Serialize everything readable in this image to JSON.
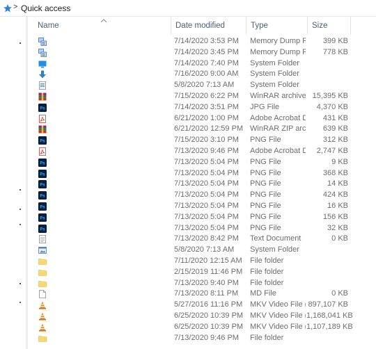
{
  "address": {
    "crumb": "Quick access",
    "separator": ">"
  },
  "columns": {
    "name": "Name",
    "date": "Date modified",
    "type": "Type",
    "size": "Size"
  },
  "rows": [
    {
      "icon": "memory-dump-icon",
      "date": "7/14/2020 3:53 PM",
      "type": "Memory Dump File",
      "size": "399 KB"
    },
    {
      "icon": "memory-dump-icon",
      "date": "7/14/2020 3:45 PM",
      "type": "Memory Dump File",
      "size": "778 KB"
    },
    {
      "icon": "desktop-folder-icon",
      "date": "7/14/2020 7:40 PM",
      "type": "System Folder",
      "size": ""
    },
    {
      "icon": "downloads-folder-icon",
      "date": "7/16/2020 9:00 AM",
      "type": "System Folder",
      "size": ""
    },
    {
      "icon": "documents-folder-icon",
      "date": "5/8/2020 7:13 AM",
      "type": "System Folder",
      "size": ""
    },
    {
      "icon": "winrar-icon",
      "date": "7/15/2020 6:22 PM",
      "type": "WinRAR archive",
      "size": "15,395 KB"
    },
    {
      "icon": "photoshop-icon",
      "date": "7/14/2020 3:51 PM",
      "type": "JPG File",
      "size": "4,370 KB"
    },
    {
      "icon": "pdf-icon",
      "date": "6/21/2020 1:00 PM",
      "type": "Adobe Acrobat D...",
      "size": "431 KB"
    },
    {
      "icon": "winrar-icon",
      "date": "6/21/2020 12:59 PM",
      "type": "WinRAR ZIP archive",
      "size": "639 KB"
    },
    {
      "icon": "photoshop-icon",
      "date": "7/15/2020 3:10 PM",
      "type": "PNG File",
      "size": "312 KB"
    },
    {
      "icon": "pdf-icon",
      "date": "7/13/2020 9:46 PM",
      "type": "Adobe Acrobat D...",
      "size": "2,747 KB"
    },
    {
      "icon": "photoshop-icon",
      "date": "7/13/2020 5:04 PM",
      "type": "PNG File",
      "size": "9 KB"
    },
    {
      "icon": "photoshop-icon",
      "date": "7/13/2020 5:04 PM",
      "type": "PNG File",
      "size": "368 KB"
    },
    {
      "icon": "photoshop-icon",
      "date": "7/13/2020 5:04 PM",
      "type": "PNG File",
      "size": "14 KB"
    },
    {
      "icon": "photoshop-icon",
      "date": "7/13/2020 5:04 PM",
      "type": "PNG File",
      "size": "424 KB"
    },
    {
      "icon": "photoshop-icon",
      "date": "7/13/2020 5:04 PM",
      "type": "PNG File",
      "size": "16 KB"
    },
    {
      "icon": "photoshop-icon",
      "date": "7/13/2020 5:04 PM",
      "type": "PNG File",
      "size": "156 KB"
    },
    {
      "icon": "photoshop-icon",
      "date": "7/13/2020 5:04 PM",
      "type": "PNG File",
      "size": "32 KB"
    },
    {
      "icon": "text-document-icon",
      "date": "7/13/2020 8:42 PM",
      "type": "Text Document",
      "size": "0 KB"
    },
    {
      "icon": "pictures-folder-icon",
      "date": "5/8/2020 7:13 AM",
      "type": "System Folder",
      "size": ""
    },
    {
      "icon": "folder-icon",
      "date": "7/11/2020 12:15 AM",
      "type": "File folder",
      "size": ""
    },
    {
      "icon": "folder-icon",
      "date": "2/15/2019 11:46 PM",
      "type": "File folder",
      "size": ""
    },
    {
      "icon": "folder-icon",
      "date": "7/13/2020 9:40 PM",
      "type": "File folder",
      "size": ""
    },
    {
      "icon": "blank-file-icon",
      "date": "7/13/2020 8:11 PM",
      "type": "MD File",
      "size": "0 KB"
    },
    {
      "icon": "vlc-icon",
      "date": "5/27/2016 11:16 PM",
      "type": "MKV Video File (V...",
      "size": "897,107 KB"
    },
    {
      "icon": "vlc-icon",
      "date": "6/25/2020 10:39 PM",
      "type": "MKV Video File (V...",
      "size": "1,168,041 KB"
    },
    {
      "icon": "vlc-icon",
      "date": "6/25/2020 10:39 PM",
      "type": "MKV Video File (V...",
      "size": "1,107,189 KB"
    },
    {
      "icon": "folder-icon",
      "date": "7/13/2020 9:46 PM",
      "type": "File folder",
      "size": ""
    }
  ]
}
